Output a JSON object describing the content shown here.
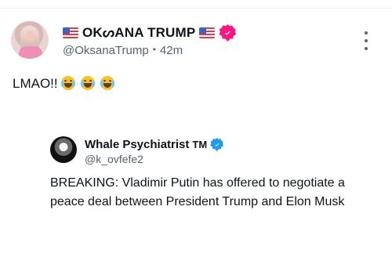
{
  "post": {
    "author": {
      "display_name": "OKᔕANA TRUMP",
      "handle": "@OksanaTrump",
      "time": "42m"
    },
    "text": "LMAO!!",
    "emojis": [
      "joy-emoji",
      "joy-emoji",
      "joy-emoji"
    ],
    "more_icon": "more-options-icon",
    "verified_icon": "verified-badge-icon"
  },
  "quote": {
    "author": {
      "display_name": "Whale Psychiatrist",
      "tm": "TM",
      "handle": "@k_ovfefe2"
    },
    "text": "BREAKING: Vladimir Putin has offered to negotiate a peace deal between President Trump and Elon Musk",
    "verified_icon": "verified-badge-icon"
  },
  "colors": {
    "text": "#0f1419",
    "muted": "#536471",
    "divider": "#eff3f4",
    "pink_badge": "#f91880",
    "blue_badge": "#1d9bf0"
  }
}
